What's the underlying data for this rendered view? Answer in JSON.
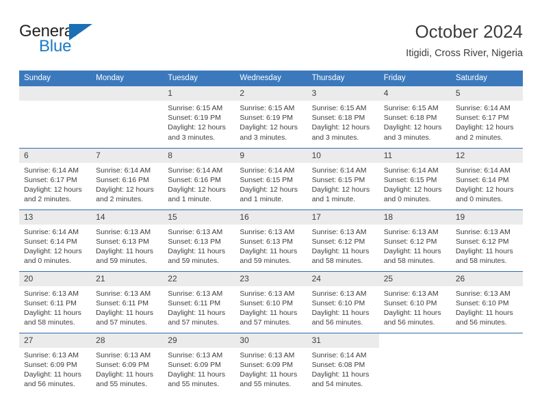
{
  "brand": {
    "name_top": "General",
    "name_bottom": "Blue",
    "logo_icon": "blue-triangle-icon",
    "color_dark": "#231f20",
    "color_blue": "#1b7ac4"
  },
  "header": {
    "title": "October 2024",
    "subtitle": "Itigidi, Cross River, Nigeria"
  },
  "theme": {
    "header_bg": "#3b79bc",
    "row_divider": "#2c6aac",
    "daynum_bg": "#ebebeb",
    "text": "#3c3c3c"
  },
  "weekdays": [
    "Sunday",
    "Monday",
    "Tuesday",
    "Wednesday",
    "Thursday",
    "Friday",
    "Saturday"
  ],
  "labels": {
    "sunrise": "Sunrise:",
    "sunset": "Sunset:",
    "daylight": "Daylight:"
  },
  "weeks": [
    [
      {
        "day": "",
        "empty": true
      },
      {
        "day": "",
        "empty": true
      },
      {
        "day": "1",
        "sunrise": "Sunrise: 6:15 AM",
        "sunset": "Sunset: 6:19 PM",
        "daylight_1": "Daylight: 12 hours",
        "daylight_2": "and 3 minutes."
      },
      {
        "day": "2",
        "sunrise": "Sunrise: 6:15 AM",
        "sunset": "Sunset: 6:19 PM",
        "daylight_1": "Daylight: 12 hours",
        "daylight_2": "and 3 minutes."
      },
      {
        "day": "3",
        "sunrise": "Sunrise: 6:15 AM",
        "sunset": "Sunset: 6:18 PM",
        "daylight_1": "Daylight: 12 hours",
        "daylight_2": "and 3 minutes."
      },
      {
        "day": "4",
        "sunrise": "Sunrise: 6:15 AM",
        "sunset": "Sunset: 6:18 PM",
        "daylight_1": "Daylight: 12 hours",
        "daylight_2": "and 3 minutes."
      },
      {
        "day": "5",
        "sunrise": "Sunrise: 6:14 AM",
        "sunset": "Sunset: 6:17 PM",
        "daylight_1": "Daylight: 12 hours",
        "daylight_2": "and 2 minutes."
      }
    ],
    [
      {
        "day": "6",
        "sunrise": "Sunrise: 6:14 AM",
        "sunset": "Sunset: 6:17 PM",
        "daylight_1": "Daylight: 12 hours",
        "daylight_2": "and 2 minutes."
      },
      {
        "day": "7",
        "sunrise": "Sunrise: 6:14 AM",
        "sunset": "Sunset: 6:16 PM",
        "daylight_1": "Daylight: 12 hours",
        "daylight_2": "and 2 minutes."
      },
      {
        "day": "8",
        "sunrise": "Sunrise: 6:14 AM",
        "sunset": "Sunset: 6:16 PM",
        "daylight_1": "Daylight: 12 hours",
        "daylight_2": "and 1 minute."
      },
      {
        "day": "9",
        "sunrise": "Sunrise: 6:14 AM",
        "sunset": "Sunset: 6:15 PM",
        "daylight_1": "Daylight: 12 hours",
        "daylight_2": "and 1 minute."
      },
      {
        "day": "10",
        "sunrise": "Sunrise: 6:14 AM",
        "sunset": "Sunset: 6:15 PM",
        "daylight_1": "Daylight: 12 hours",
        "daylight_2": "and 1 minute."
      },
      {
        "day": "11",
        "sunrise": "Sunrise: 6:14 AM",
        "sunset": "Sunset: 6:15 PM",
        "daylight_1": "Daylight: 12 hours",
        "daylight_2": "and 0 minutes."
      },
      {
        "day": "12",
        "sunrise": "Sunrise: 6:14 AM",
        "sunset": "Sunset: 6:14 PM",
        "daylight_1": "Daylight: 12 hours",
        "daylight_2": "and 0 minutes."
      }
    ],
    [
      {
        "day": "13",
        "sunrise": "Sunrise: 6:14 AM",
        "sunset": "Sunset: 6:14 PM",
        "daylight_1": "Daylight: 12 hours",
        "daylight_2": "and 0 minutes."
      },
      {
        "day": "14",
        "sunrise": "Sunrise: 6:13 AM",
        "sunset": "Sunset: 6:13 PM",
        "daylight_1": "Daylight: 11 hours",
        "daylight_2": "and 59 minutes."
      },
      {
        "day": "15",
        "sunrise": "Sunrise: 6:13 AM",
        "sunset": "Sunset: 6:13 PM",
        "daylight_1": "Daylight: 11 hours",
        "daylight_2": "and 59 minutes."
      },
      {
        "day": "16",
        "sunrise": "Sunrise: 6:13 AM",
        "sunset": "Sunset: 6:13 PM",
        "daylight_1": "Daylight: 11 hours",
        "daylight_2": "and 59 minutes."
      },
      {
        "day": "17",
        "sunrise": "Sunrise: 6:13 AM",
        "sunset": "Sunset: 6:12 PM",
        "daylight_1": "Daylight: 11 hours",
        "daylight_2": "and 58 minutes."
      },
      {
        "day": "18",
        "sunrise": "Sunrise: 6:13 AM",
        "sunset": "Sunset: 6:12 PM",
        "daylight_1": "Daylight: 11 hours",
        "daylight_2": "and 58 minutes."
      },
      {
        "day": "19",
        "sunrise": "Sunrise: 6:13 AM",
        "sunset": "Sunset: 6:12 PM",
        "daylight_1": "Daylight: 11 hours",
        "daylight_2": "and 58 minutes."
      }
    ],
    [
      {
        "day": "20",
        "sunrise": "Sunrise: 6:13 AM",
        "sunset": "Sunset: 6:11 PM",
        "daylight_1": "Daylight: 11 hours",
        "daylight_2": "and 58 minutes."
      },
      {
        "day": "21",
        "sunrise": "Sunrise: 6:13 AM",
        "sunset": "Sunset: 6:11 PM",
        "daylight_1": "Daylight: 11 hours",
        "daylight_2": "and 57 minutes."
      },
      {
        "day": "22",
        "sunrise": "Sunrise: 6:13 AM",
        "sunset": "Sunset: 6:11 PM",
        "daylight_1": "Daylight: 11 hours",
        "daylight_2": "and 57 minutes."
      },
      {
        "day": "23",
        "sunrise": "Sunrise: 6:13 AM",
        "sunset": "Sunset: 6:10 PM",
        "daylight_1": "Daylight: 11 hours",
        "daylight_2": "and 57 minutes."
      },
      {
        "day": "24",
        "sunrise": "Sunrise: 6:13 AM",
        "sunset": "Sunset: 6:10 PM",
        "daylight_1": "Daylight: 11 hours",
        "daylight_2": "and 56 minutes."
      },
      {
        "day": "25",
        "sunrise": "Sunrise: 6:13 AM",
        "sunset": "Sunset: 6:10 PM",
        "daylight_1": "Daylight: 11 hours",
        "daylight_2": "and 56 minutes."
      },
      {
        "day": "26",
        "sunrise": "Sunrise: 6:13 AM",
        "sunset": "Sunset: 6:10 PM",
        "daylight_1": "Daylight: 11 hours",
        "daylight_2": "and 56 minutes."
      }
    ],
    [
      {
        "day": "27",
        "sunrise": "Sunrise: 6:13 AM",
        "sunset": "Sunset: 6:09 PM",
        "daylight_1": "Daylight: 11 hours",
        "daylight_2": "and 56 minutes."
      },
      {
        "day": "28",
        "sunrise": "Sunrise: 6:13 AM",
        "sunset": "Sunset: 6:09 PM",
        "daylight_1": "Daylight: 11 hours",
        "daylight_2": "and 55 minutes."
      },
      {
        "day": "29",
        "sunrise": "Sunrise: 6:13 AM",
        "sunset": "Sunset: 6:09 PM",
        "daylight_1": "Daylight: 11 hours",
        "daylight_2": "and 55 minutes."
      },
      {
        "day": "30",
        "sunrise": "Sunrise: 6:13 AM",
        "sunset": "Sunset: 6:09 PM",
        "daylight_1": "Daylight: 11 hours",
        "daylight_2": "and 55 minutes."
      },
      {
        "day": "31",
        "sunrise": "Sunrise: 6:14 AM",
        "sunset": "Sunset: 6:08 PM",
        "daylight_1": "Daylight: 11 hours",
        "daylight_2": "and 54 minutes."
      },
      {
        "day": "",
        "blank": true
      },
      {
        "day": "",
        "blank": true
      }
    ]
  ]
}
